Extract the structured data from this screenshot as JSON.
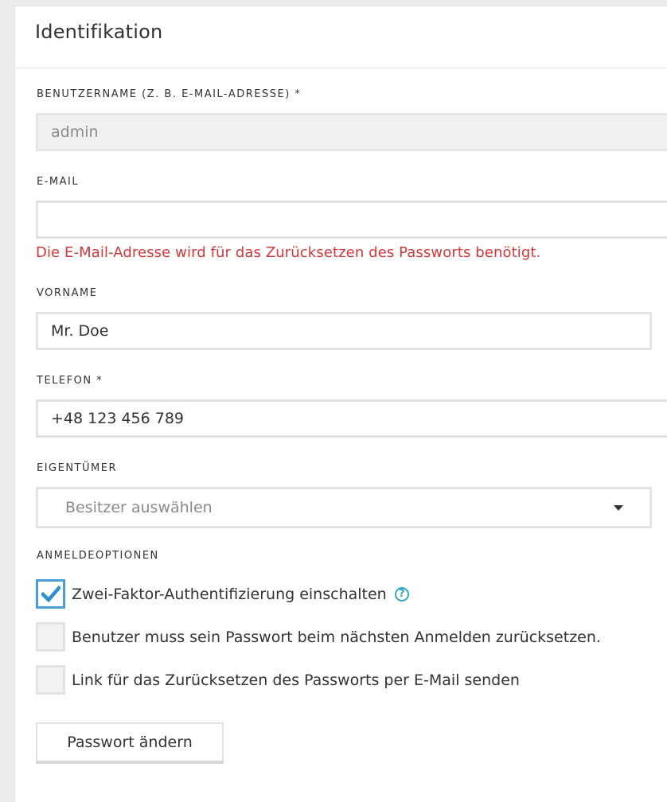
{
  "section": {
    "title": "Identifikation"
  },
  "fields": {
    "username": {
      "label": "BENUTZERNAME (Z. B. E-MAIL-ADRESSE) *",
      "value": "admin"
    },
    "email": {
      "label": "E-MAIL",
      "value": "",
      "error": "Die E-Mail-Adresse wird für das Zurücksetzen des Passworts benötigt."
    },
    "firstname": {
      "label": "VORNAME",
      "value": "Mr. Doe"
    },
    "phone": {
      "label": "TELEFON *",
      "value": "+48 123 456 789"
    },
    "owner": {
      "label": "EIGENTÜMER",
      "placeholder": "Besitzer auswählen"
    }
  },
  "login_options": {
    "label": "ANMELDEOPTIONEN",
    "options": [
      {
        "label": "Zwei-Faktor-Authentifizierung einschalten",
        "checked": true,
        "help_icon": "question-circle-icon",
        "help_glyph": "?"
      },
      {
        "label": "Benutzer muss sein Passwort beim nächsten Anmelden zurücksetzen.",
        "checked": false
      },
      {
        "label": "Link für das Zurücksetzen des Passworts per E-Mail senden",
        "checked": false
      }
    ]
  },
  "actions": {
    "change_password": "Passwort ändern"
  },
  "colors": {
    "error": "#d2373a",
    "checkbox_accent": "#4a9fd8",
    "help_icon": "#2fa9c4"
  }
}
